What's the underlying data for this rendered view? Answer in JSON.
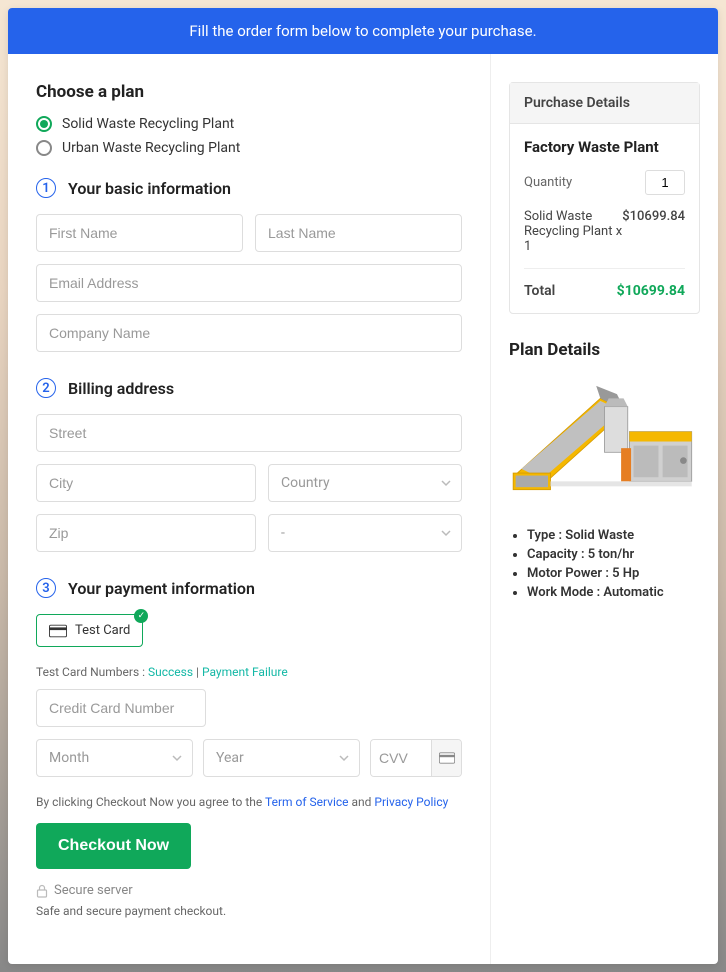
{
  "banner": "Fill the order form below to complete your purchase.",
  "choosePlan": {
    "title": "Choose a plan",
    "options": [
      {
        "label": "Solid Waste Recycling Plant",
        "selected": true
      },
      {
        "label": "Urban Waste Recycling Plant",
        "selected": false
      }
    ]
  },
  "step1": {
    "num": "1",
    "title": "Your basic information",
    "firstName": "First Name",
    "lastName": "Last Name",
    "email": "Email Address",
    "company": "Company Name"
  },
  "step2": {
    "num": "2",
    "title": "Billing address",
    "street": "Street",
    "city": "City",
    "country": "Country",
    "zip": "Zip",
    "state": "-"
  },
  "step3": {
    "num": "3",
    "title": "Your payment information",
    "cardLabel": "Test  Card",
    "testNote": "Test Card Numbers : ",
    "successLink": "Success",
    "sep": " | ",
    "failureLink": "Payment Failure",
    "creditPlaceholder": "Credit Card Number",
    "month": "Month",
    "year": "Year",
    "cvv": "CVV"
  },
  "tos": {
    "prefix": "By clicking Checkout Now you agree to the ",
    "termLink": "Term of Service",
    "and": " and ",
    "privacyLink": "Privacy Policy"
  },
  "checkoutBtn": "Checkout Now",
  "secure": "Secure server",
  "safeNote": "Safe and secure payment checkout.",
  "purchase": {
    "header": "Purchase Details",
    "planName": "Factory Waste Plant",
    "qtyLabel": "Quantity",
    "qtyValue": "1",
    "itemName": "Solid Waste Recycling Plant x 1",
    "itemPrice": "$10699.84",
    "totalLabel": "Total",
    "totalPrice": "$10699.84"
  },
  "planDetails": {
    "title": "Plan Details",
    "specs": [
      "Type : Solid Waste",
      "Capacity : 5 ton/hr",
      "Motor Power : 5 Hp",
      "Work Mode : Automatic"
    ]
  }
}
